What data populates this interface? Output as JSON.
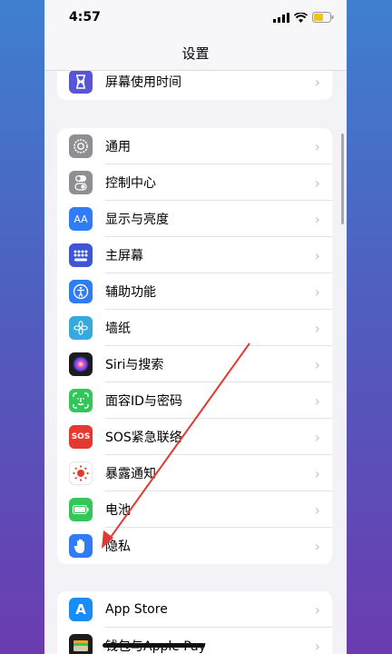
{
  "status": {
    "time": "4:57"
  },
  "nav": {
    "title": "设置"
  },
  "group0": [
    {
      "label": "屏幕使用时间",
      "icon": "hourglass-icon",
      "color": "#5856d6"
    }
  ],
  "group1": [
    {
      "label": "通用",
      "icon": "gear-icon",
      "color": "#8e8e93"
    },
    {
      "label": "控制中心",
      "icon": "toggles-icon",
      "color": "#8e8e93"
    },
    {
      "label": "显示与亮度",
      "icon": "text-size-icon",
      "color": "#2f7cf6",
      "glyph": "AA"
    },
    {
      "label": "主屏幕",
      "icon": "home-grid-icon",
      "color": "#3d56d6"
    },
    {
      "label": "辅助功能",
      "icon": "accessibility-icon",
      "color": "#2f7cf6"
    },
    {
      "label": "墙纸",
      "icon": "wallpaper-flower-icon",
      "color": "#36aadc"
    },
    {
      "label": "Siri与搜索",
      "icon": "siri-icon",
      "color": "#222"
    },
    {
      "label": "面容ID与密码",
      "icon": "face-id-icon",
      "color": "#33c759"
    },
    {
      "label": "SOS紧急联络",
      "icon": "sos-icon",
      "color": "#e5392f",
      "glyph": "SOS"
    },
    {
      "label": "暴露通知",
      "icon": "exposure-icon",
      "color": "#ffffff"
    },
    {
      "label": "电池",
      "icon": "battery-icon",
      "color": "#33c759"
    },
    {
      "label": "隐私",
      "icon": "hand-icon",
      "color": "#2f7cf6"
    }
  ],
  "group2": [
    {
      "label": "App Store",
      "icon": "app-store-icon",
      "color": "#1a8cf7",
      "glyph": "A"
    },
    {
      "label": "钱包与Apple Pay",
      "icon": "wallet-icon",
      "color": "#222"
    }
  ]
}
